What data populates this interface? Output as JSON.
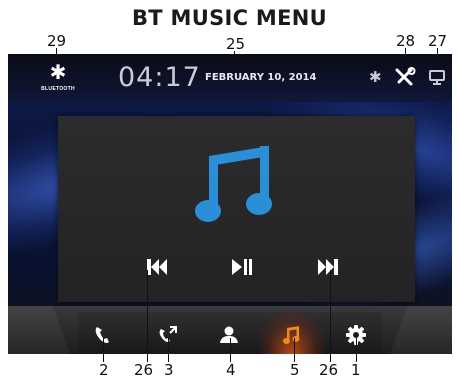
{
  "page_heading": "BT MUSIC MENU",
  "callouts": {
    "c29": "29",
    "c25": "25",
    "c28": "28",
    "c27": "27",
    "c2": "2",
    "c26a": "26",
    "c3": "3",
    "c4": "4",
    "c5": "5",
    "c26b": "26",
    "c1": "1"
  },
  "status_bar": {
    "bt_glyph": "✱",
    "source_caption": "BLUETOOTH",
    "time": "04:17",
    "date": "FEBRUARY 10, 2014",
    "bt_status_glyph": "✱"
  },
  "player": {
    "album_art_icon": "music-note-icon",
    "controls": [
      "previous-track-icon",
      "play-pause-icon",
      "next-track-icon"
    ]
  },
  "bottom_nav": {
    "items": [
      {
        "icon": "phone-icon"
      },
      {
        "icon": "call-log-icon"
      },
      {
        "icon": "contacts-icon"
      },
      {
        "icon": "music-icon",
        "active": true
      },
      {
        "icon": "settings-gear-icon"
      }
    ]
  },
  "colors": {
    "accent_blue": "#2a8fd6",
    "active_orange": "#f08a1c",
    "icon_white": "#ffffff",
    "status_grey": "#c8cbd3"
  }
}
